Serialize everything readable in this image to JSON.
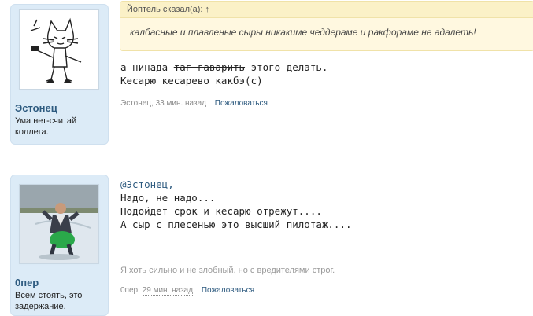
{
  "posts": [
    {
      "username": "Эстонец",
      "user_title": "Ума нет-считай коллега.",
      "quote": {
        "header": "Йоптель сказал(а): ↑",
        "text": "калбасные и плавленые сыры никакиме чеддераме и ракфораме не адалеть!"
      },
      "message": {
        "line1_before": "а нинада ",
        "line1_strike": "таг гаварить",
        "line1_after": " этого делать.",
        "line2": "Кесарю кесарево какбэ(с)"
      },
      "author_meta": "Эстонец,",
      "date": "33 мин. назад",
      "report_label": "Пожаловаться"
    },
    {
      "username": "0пер",
      "user_title": "Всем стоять, это задержание.",
      "message": {
        "line1": "@Эстонец,",
        "line2": "Надо, не надо...",
        "line3": "Подойдет срок и кесарю отрежут....",
        "line4": "А сыр с плесенью это высший пилотаж...."
      },
      "signature": "Я хоть сильно и не злобный, но с вредителями строг.",
      "author_meta": "0пер,",
      "date": "29 мин. назад",
      "report_label": "Пожаловаться"
    }
  ],
  "colors": {
    "accent": "#2d5a7f",
    "panel": "#dcebf7",
    "quote_bg": "#fff8e0"
  }
}
